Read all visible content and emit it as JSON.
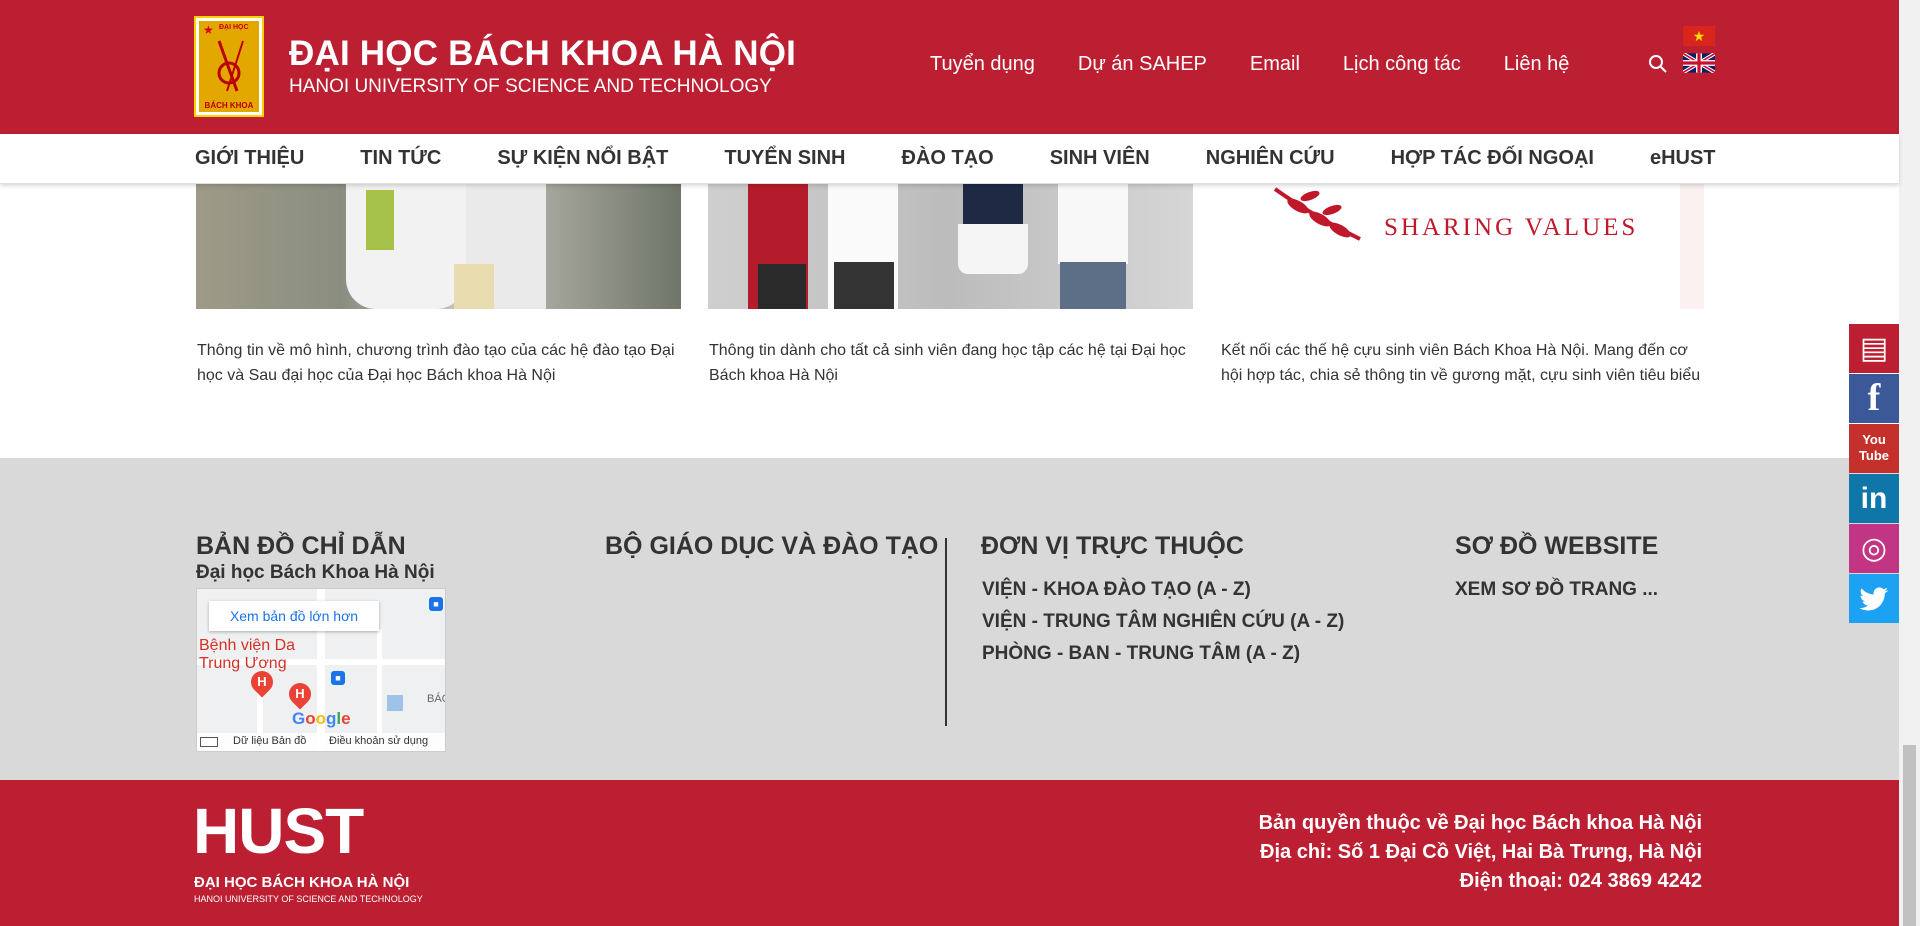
{
  "header": {
    "title": "ĐẠI HỌC BÁCH KHOA HÀ NỘI",
    "subtitle": "HANOI UNIVERSITY OF SCIENCE AND TECHNOLOGY",
    "logo": {
      "top_text": "ĐẠI HỌC",
      "bottom_text": "BÁCH KHOA"
    },
    "top_links": [
      "Tuyển dụng",
      "Dự án SAHEP",
      "Email",
      "Lịch công tác",
      "Liên hệ"
    ],
    "icons": {
      "search": "search-icon",
      "lang_vn": "vietnam-flag-icon",
      "lang_en": "uk-flag-icon"
    },
    "brand_color": "#bc1e32"
  },
  "nav": {
    "items": [
      "GIỚI THIỆU",
      "TIN TỨC",
      "SỰ KIỆN NỔI BẬT",
      "TUYỂN SINH",
      "ĐÀO TẠO",
      "SINH VIÊN",
      "NGHIÊN CỨU",
      "HỢP TÁC ĐỐI NGOẠI",
      "eHUST"
    ]
  },
  "cards": [
    {
      "description": "Thông tin về mô hình, chương trình đào tạo của các hệ đào tạo Đại học và Sau đại học của Đại học Bách khoa Hà Nội"
    },
    {
      "description": "Thông tin dành cho tất cả sinh viên đang học tập các hệ tại Đại học Bách khoa Hà Nội"
    },
    {
      "description": "Kết nối các thế hệ cựu sinh viên Bách Khoa Hà Nội. Mang đến cơ hội hợp tác, chia sẻ thông tin về gương mặt, cựu sinh viên tiêu biểu",
      "image_text": "SHARING VALUES"
    }
  ],
  "footer": {
    "map_section": {
      "heading": "BẢN ĐỒ CHỈ DẪN",
      "subheading": "Đại học Bách Khoa Hà Nội",
      "map_button": "Xem bản đồ lớn hơn",
      "map_label": "Bệnh viện Da\nTrung Ương",
      "map_label2": "BÁC",
      "google": "Google",
      "map_data": "Dữ liệu Bản đồ",
      "map_terms": "Điều khoản sử dụng"
    },
    "ministry_heading": "BỘ GIÁO DỤC VÀ ĐÀO TẠO",
    "units": {
      "heading": "ĐƠN VỊ TRỰC THUỘC",
      "links": [
        "VIỆN - KHOA ĐÀO TẠO (A - Z)",
        "VIỆN - TRUNG TÂM NGHIÊN CỨU (A - Z)",
        "PHÒNG - BAN - TRUNG TÂM (A - Z)"
      ]
    },
    "sitemap": {
      "heading": "SƠ ĐỒ WEBSITE",
      "link": "XEM SƠ ĐỒ TRANG ..."
    },
    "bottom": {
      "logo_text": "HUST",
      "logo_vn": "ĐẠI HỌC BÁCH KHOA HÀ NỘI",
      "logo_en": "HANOI UNIVERSITY OF SCIENCE AND TECHNOLOGY",
      "copyright": "Bản quyền thuộc về Đại học Bách khoa Hà Nội",
      "address": "Địa chỉ: Số 1 Đại Cồ Việt, Hai Bà Trưng, Hà Nội",
      "phone": "Điện thoại: 024 3869 4242"
    }
  },
  "social": [
    {
      "icon": "book-icon",
      "color": "#bc1e32",
      "glyph": "▤"
    },
    {
      "icon": "facebook-icon",
      "color": "#3b5998",
      "glyph": "f"
    },
    {
      "icon": "youtube-icon",
      "color": "#c4302b",
      "glyph": "You\nTube"
    },
    {
      "icon": "linkedin-icon",
      "color": "#0e76a8",
      "glyph": "in"
    },
    {
      "icon": "instagram-icon",
      "color": "#c13584",
      "glyph": "◎"
    },
    {
      "icon": "twitter-icon",
      "color": "#1da1f2",
      "glyph": "🐦"
    }
  ]
}
